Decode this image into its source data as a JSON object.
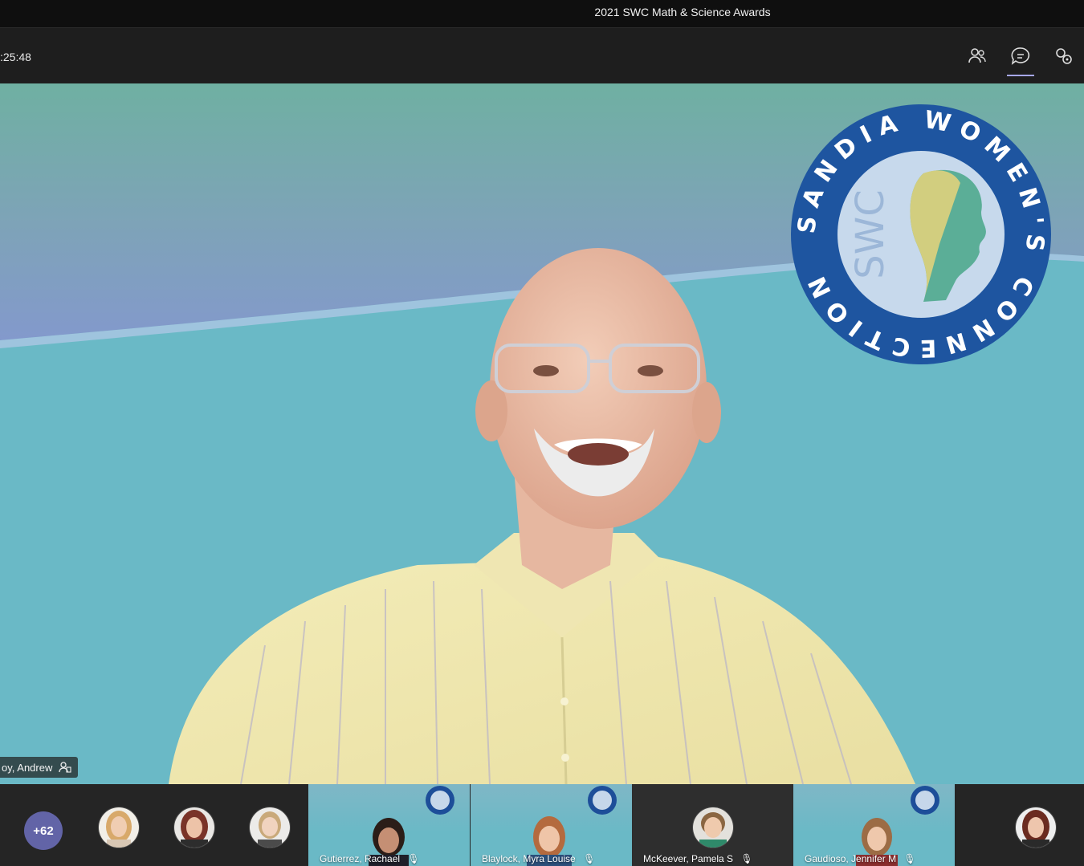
{
  "window": {
    "title": "2021 SWC Math & Science Awards"
  },
  "toolbar": {
    "timer": ":25:48",
    "icons": [
      "participants-icon",
      "chat-icon",
      "more-icon"
    ]
  },
  "stage": {
    "logo": {
      "ring_text": "SANDIA WOMEN'S CONNECTION",
      "center_text": "SWC",
      "colors": {
        "ring": "#1e55a0",
        "inner": "#c7d9ec"
      }
    },
    "speaker_name": "oy, Andrew",
    "background_colors": {
      "top": "#6fb0a2",
      "mid": "#7f9fc6",
      "main": "#6ab9c6"
    }
  },
  "strip": {
    "overflow_count": "+62",
    "tiles": [
      {
        "name": "Gutierrez, Rachael",
        "mic": "mic-off-icon"
      },
      {
        "name": "Blaylock, Myra Louise",
        "mic": "mic-off-icon"
      },
      {
        "name": "McKeever, Pamela S",
        "mic": "mic-off-icon"
      },
      {
        "name": "Gaudioso, Jennifer M",
        "mic": "mic-off-icon"
      }
    ]
  }
}
